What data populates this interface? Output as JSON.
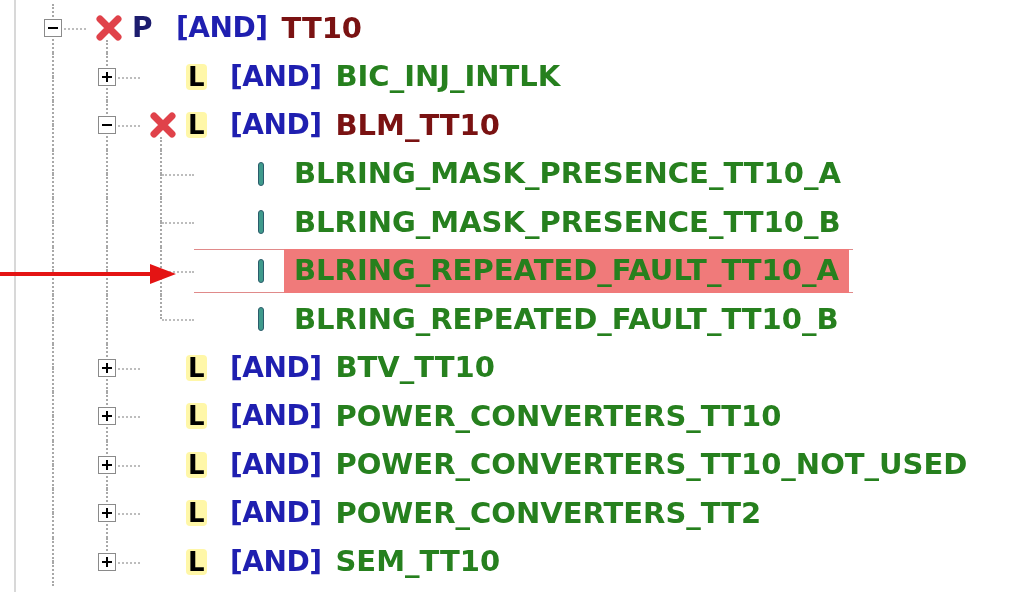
{
  "tree": [
    {
      "kind": "root",
      "letter": "P",
      "operator": "[AND]",
      "name": "TT10",
      "failed": true,
      "expanded": true,
      "selected": false,
      "children": [
        {
          "kind": "branch",
          "letter": "L",
          "operator": "[AND]",
          "name": "BIC_INJ_INTLK",
          "failed": false,
          "expanded": false,
          "selected": false
        },
        {
          "kind": "branch",
          "letter": "L",
          "operator": "[AND]",
          "name": "BLM_TT10",
          "failed": true,
          "expanded": true,
          "selected": false,
          "children": [
            {
              "kind": "leaf",
              "name": "BLRING_MASK_PRESENCE_TT10_A",
              "selected": false
            },
            {
              "kind": "leaf",
              "name": "BLRING_MASK_PRESENCE_TT10_B",
              "selected": false
            },
            {
              "kind": "leaf",
              "name": "BLRING_REPEATED_FAULT_TT10_A",
              "selected": true
            },
            {
              "kind": "leaf",
              "name": "BLRING_REPEATED_FAULT_TT10_B",
              "selected": false
            }
          ]
        },
        {
          "kind": "branch",
          "letter": "L",
          "operator": "[AND]",
          "name": "BTV_TT10",
          "failed": false,
          "expanded": false,
          "selected": false
        },
        {
          "kind": "branch",
          "letter": "L",
          "operator": "[AND]",
          "name": "POWER_CONVERTERS_TT10",
          "failed": false,
          "expanded": false,
          "selected": false
        },
        {
          "kind": "branch",
          "letter": "L",
          "operator": "[AND]",
          "name": "POWER_CONVERTERS_TT10_NOT_USED",
          "failed": false,
          "expanded": false,
          "selected": false
        },
        {
          "kind": "branch",
          "letter": "L",
          "operator": "[AND]",
          "name": "POWER_CONVERTERS_TT2",
          "failed": false,
          "expanded": false,
          "selected": false
        },
        {
          "kind": "branch",
          "letter": "L",
          "operator": "[AND]",
          "name": "SEM_TT10",
          "failed": false,
          "expanded": false,
          "selected": false
        }
      ]
    }
  ]
}
